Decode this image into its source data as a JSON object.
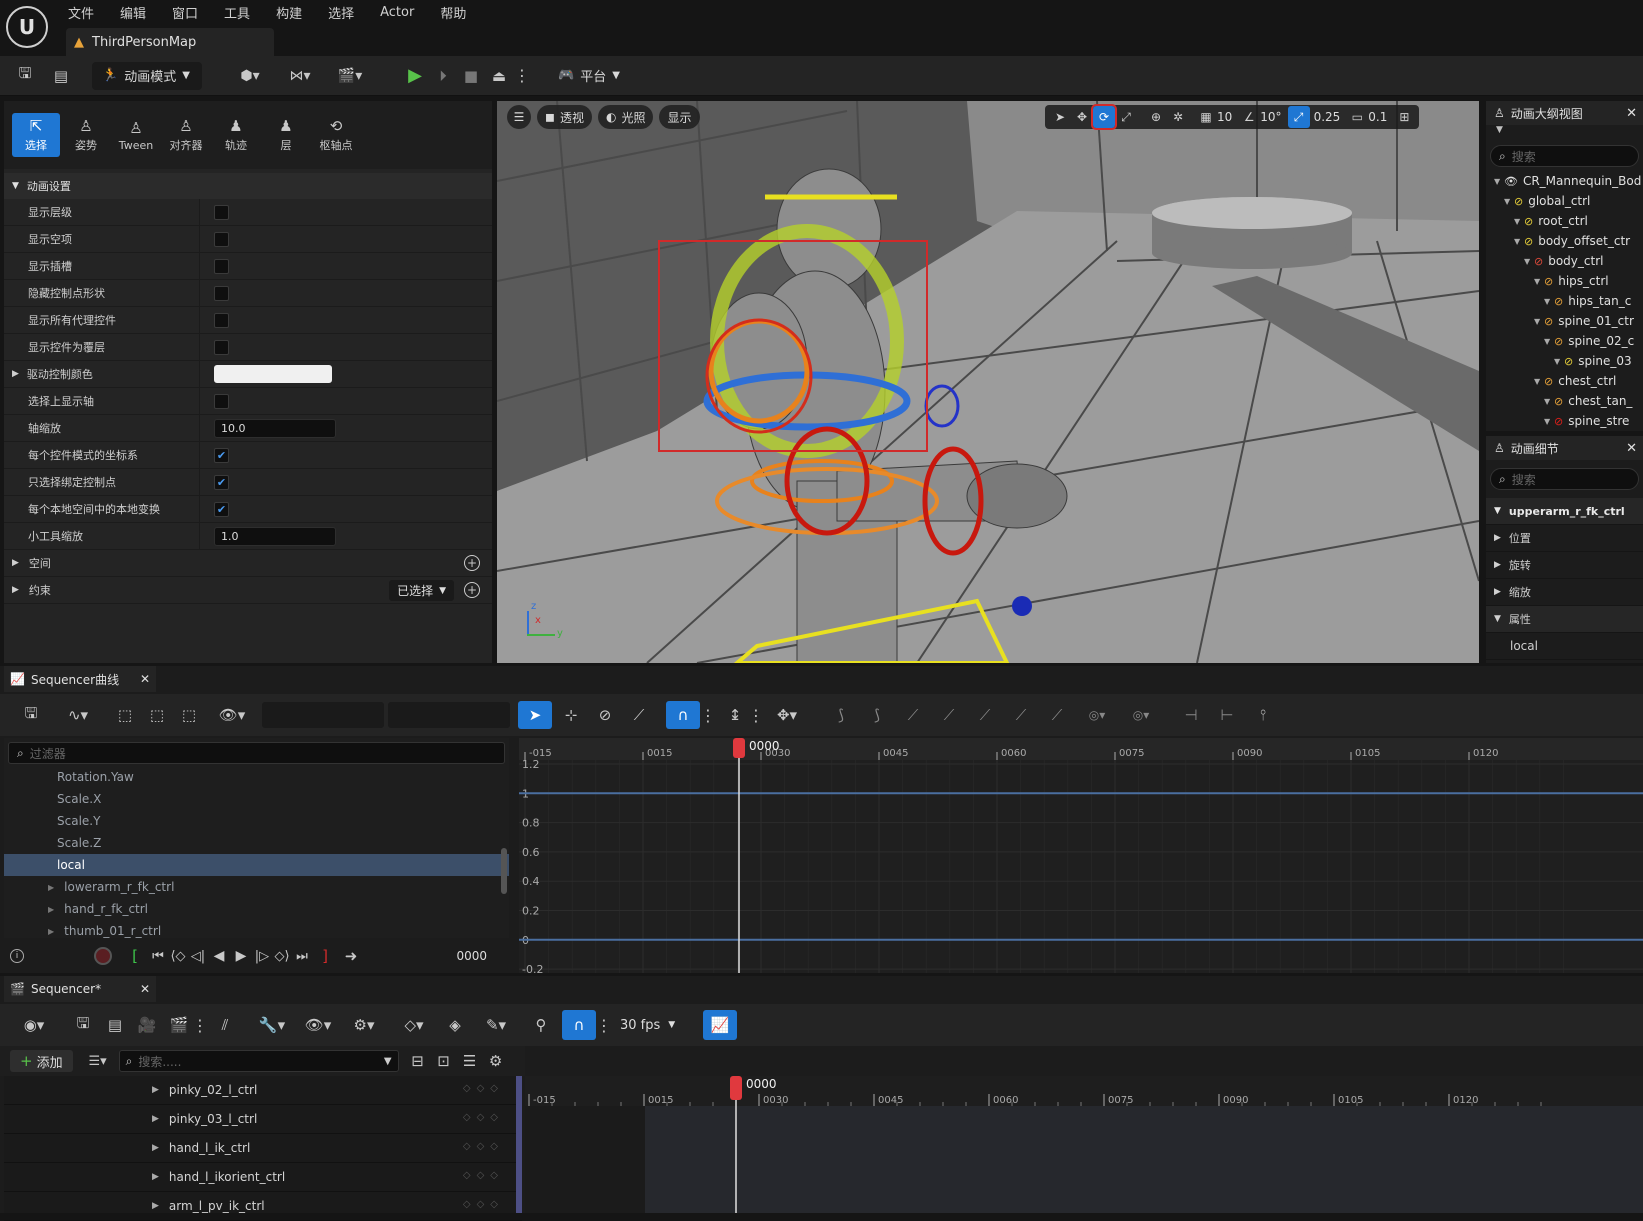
{
  "menu": {
    "items": [
      "文件",
      "编辑",
      "窗口",
      "工具",
      "构建",
      "选择",
      "Actor",
      "帮助"
    ],
    "map_tab": "ThirdPersonMap"
  },
  "toolbar": {
    "mode_label": "动画模式",
    "platform_label": "平台"
  },
  "modes": [
    {
      "label": "选择",
      "icon": "select-icon",
      "active": true
    },
    {
      "label": "姿势",
      "icon": "pose-icon",
      "active": false
    },
    {
      "label": "Tween",
      "icon": "tween-icon",
      "active": false
    },
    {
      "label": "对齐器",
      "icon": "aligner-icon",
      "active": false
    },
    {
      "label": "轨迹",
      "icon": "trail-icon",
      "active": false
    },
    {
      "label": "层",
      "icon": "layer-icon",
      "active": false
    },
    {
      "label": "枢轴点",
      "icon": "pivot-icon",
      "active": false
    }
  ],
  "anim_settings": {
    "header": "动画设置",
    "rows": [
      {
        "label": "显示层级",
        "type": "checkbox",
        "checked": false
      },
      {
        "label": "显示空项",
        "type": "checkbox",
        "checked": false
      },
      {
        "label": "显示插槽",
        "type": "checkbox",
        "checked": false
      },
      {
        "label": "隐藏控制点形状",
        "type": "checkbox",
        "checked": false
      },
      {
        "label": "显示所有代理控件",
        "type": "checkbox",
        "checked": false
      },
      {
        "label": "显示控件为覆层",
        "type": "checkbox",
        "checked": false
      },
      {
        "label": "驱动控制颜色",
        "type": "color",
        "expandable": true
      },
      {
        "label": "选择上显示轴",
        "type": "checkbox",
        "checked": false
      },
      {
        "label": "轴缩放",
        "type": "number",
        "value": "10.0"
      },
      {
        "label": "每个控件模式的坐标系",
        "type": "checkbox",
        "checked": true
      },
      {
        "label": "只选择绑定控制点",
        "type": "checkbox",
        "checked": true
      },
      {
        "label": "每个本地空间中的本地变换",
        "type": "checkbox",
        "checked": true
      },
      {
        "label": "小工具缩放",
        "type": "number",
        "value": "1.0"
      }
    ],
    "space_header": "空间",
    "constraint_header": "约束",
    "constraint_dropdown": "已选择"
  },
  "viewport": {
    "perspective": "透视",
    "lighting": "光照",
    "show": "显示",
    "grid_snap": "10",
    "angle_snap": "10°",
    "scale_snap": "0.25",
    "camera_speed": "0.1",
    "axis_z": "z",
    "axis_x": "x",
    "axis_y": "y"
  },
  "outliner": {
    "title": "动画大纲视图",
    "search_placeholder": "搜索",
    "items": [
      {
        "label": "CR_Mannequin_Bod",
        "depth": 0,
        "color": "#e0e0e0",
        "eye": true
      },
      {
        "label": "global_ctrl",
        "depth": 1,
        "color": "#e7d03a"
      },
      {
        "label": "root_ctrl",
        "depth": 2,
        "color": "#e7d03a"
      },
      {
        "label": "body_offset_ctr",
        "depth": 2,
        "color": "#e7d03a"
      },
      {
        "label": "body_ctrl",
        "depth": 3,
        "color": "#e04a3a"
      },
      {
        "label": "hips_ctrl",
        "depth": 4,
        "color": "#e8a33a"
      },
      {
        "label": "hips_tan_c",
        "depth": 5,
        "color": "#e8a33a"
      },
      {
        "label": "spine_01_ctr",
        "depth": 4,
        "color": "#e8a33a"
      },
      {
        "label": "spine_02_c",
        "depth": 5,
        "color": "#e8a33a"
      },
      {
        "label": "spine_03",
        "depth": 6,
        "color": "#e7d03a"
      },
      {
        "label": "chest_ctrl",
        "depth": 4,
        "color": "#e8a33a"
      },
      {
        "label": "chest_tan_",
        "depth": 5,
        "color": "#e8a33a"
      },
      {
        "label": "spine_stre",
        "depth": 5,
        "color": "#e0201a"
      }
    ]
  },
  "details": {
    "title": "动画细节",
    "search_placeholder": "搜索",
    "control": "upperarm_r_fk_ctrl",
    "sections": [
      "位置",
      "旋转",
      "缩放",
      "属性"
    ],
    "attr_value": "local"
  },
  "curve_editor": {
    "tab": "Sequencer曲线",
    "filter_placeholder": "过滤器",
    "items": [
      {
        "label": "Rotation.Yaw",
        "selected": false,
        "child": false
      },
      {
        "label": "Scale.X",
        "selected": false,
        "child": false
      },
      {
        "label": "Scale.Y",
        "selected": false,
        "child": false
      },
      {
        "label": "Scale.Z",
        "selected": false,
        "child": false
      },
      {
        "label": "local",
        "selected": true,
        "child": false
      },
      {
        "label": "lowerarm_r_fk_ctrl",
        "selected": false,
        "child": true
      },
      {
        "label": "hand_r_fk_ctrl",
        "selected": false,
        "child": true
      },
      {
        "label": "thumb_01_r_ctrl",
        "selected": false,
        "child": true
      }
    ],
    "frame": "0000",
    "time_ticks": [
      "-015",
      "0015",
      "0030",
      "0045",
      "0060",
      "0075",
      "0090",
      "0105",
      "0120"
    ],
    "y_ticks": [
      "1.2",
      "1",
      "0.8",
      "0.6",
      "0.4",
      "0.2",
      "0",
      "-0.2"
    ],
    "playhead": "0000"
  },
  "sequencer": {
    "tab": "Sequencer*",
    "add_label": "添加",
    "search_placeholder": "搜索.....",
    "fps": "30 fps",
    "playhead": "0000",
    "time_ticks": [
      "-015",
      "0015",
      "0030",
      "0045",
      "0060",
      "0075",
      "0090",
      "0105",
      "0120"
    ],
    "tracks": [
      "pinky_02_l_ctrl",
      "pinky_03_l_ctrl",
      "hand_l_ik_ctrl",
      "hand_l_ikorient_ctrl",
      "arm_l_pv_ik_ctrl"
    ]
  },
  "colors": {
    "accent": "#1f77d3",
    "playhead": "#e0393e",
    "play_green": "#58c24a"
  }
}
